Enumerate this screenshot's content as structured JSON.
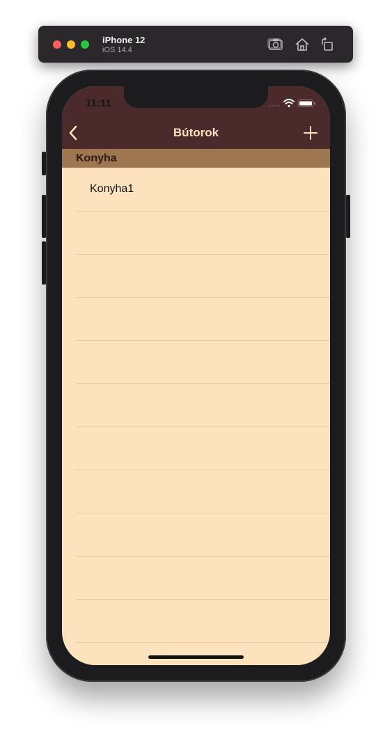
{
  "simulator": {
    "device_name": "iPhone 12",
    "os_version": "iOS 14.4",
    "toolbar_icons": [
      "screenshot-icon",
      "home-icon",
      "rotate-icon"
    ]
  },
  "status_bar": {
    "time": "11:11",
    "icons": [
      "cellular-icon",
      "wifi-icon",
      "battery-icon"
    ]
  },
  "nav": {
    "title": "Bútorok",
    "back_icon": "chevron-left-icon",
    "add_icon": "plus-icon"
  },
  "list": {
    "section_title": "Konyha",
    "items": [
      "Konyha1"
    ]
  },
  "colors": {
    "nav_bar": "#4a2a2a",
    "nav_tint": "#fce3bd",
    "section_header": "#9e7650",
    "background": "#fce3bd",
    "separator": "#e4ccaa"
  }
}
